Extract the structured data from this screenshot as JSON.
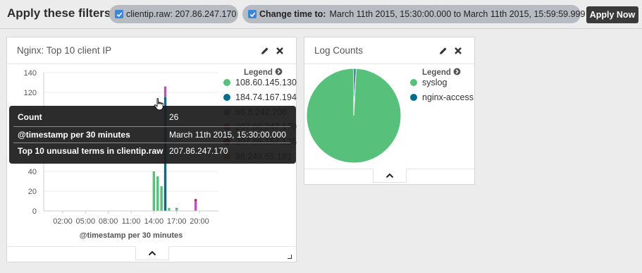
{
  "filters": {
    "title": "Apply these filters?",
    "pill1": {
      "text": "clientip.raw: 207.86.247.170"
    },
    "pill2": {
      "bold": "Change time to:",
      "text": "March 11th 2015, 15:30:00.000 to March 11th 2015, 15:59:59.999"
    },
    "apply_label": "Apply Now"
  },
  "nginx_panel": {
    "title": "Nginx: Top 10 client IP",
    "legend_title": "Legend",
    "legend": [
      {
        "label": "108.60.145.130",
        "color": "#57c17b"
      },
      {
        "label": "184.74.167.194",
        "color": "#006e8a"
      },
      {
        "label": "66.8.242.206",
        "color": "#6f87d8"
      },
      {
        "label": "207.86.247.170",
        "color": "#bc52bc"
      },
      {
        "label": "207.86.157.126",
        "color": "#9e3533"
      },
      {
        "label": "98.249.65.183",
        "color": "#daa05d"
      }
    ],
    "xlabel": "@timestamp per 30 minutes"
  },
  "log_panel": {
    "title": "Log Counts",
    "legend_title": "Legend",
    "legend": [
      {
        "label": "syslog",
        "color": "#57c17b"
      },
      {
        "label": "nginx-access",
        "color": "#006e8a"
      }
    ]
  },
  "tooltip": {
    "rows": [
      {
        "label": "Count",
        "value": "26"
      },
      {
        "label": "@timestamp per 30 minutes",
        "value": "March 11th 2015, 15:30:00.000"
      },
      {
        "label": "Top 10 unusual terms in clientip.raw",
        "value": "207.86.247.170"
      }
    ]
  },
  "chart_data": [
    {
      "type": "bar",
      "xlabel": "@timestamp per 30 minutes",
      "ylabel": "",
      "ylim": [
        0,
        140
      ],
      "yticks": [
        0,
        20,
        40,
        60,
        80,
        100,
        120,
        140
      ],
      "xticks": [
        "02:00",
        "05:00",
        "08:00",
        "11:00",
        "14:00",
        "17:00",
        "20:00"
      ],
      "x_domain_hours": [
        -0.5,
        22.5
      ],
      "stacked": true,
      "series": [
        {
          "name": "108.60.145.130",
          "color": "#57c17b",
          "points": [
            [
              14.0,
              40
            ],
            [
              14.5,
              35
            ],
            [
              15.0,
              25
            ],
            [
              16.0,
              3
            ],
            [
              17.0,
              2
            ]
          ]
        },
        {
          "name": "184.74.167.194",
          "color": "#006e8a",
          "points": [
            [
              15.5,
              115
            ]
          ]
        },
        {
          "name": "207.86.247.170",
          "color": "#bc52bc",
          "points": [
            [
              15.5,
              11
            ],
            [
              17.0,
              1
            ],
            [
              19.5,
              10
            ]
          ]
        },
        {
          "name": "207.86.157.126",
          "color": "#9e3533",
          "points": [
            [
              19.5,
              2
            ]
          ]
        }
      ]
    },
    {
      "type": "pie",
      "title": "Log Counts",
      "labels": [
        "syslog",
        "nginx-access"
      ],
      "values": [
        99.2,
        0.8
      ],
      "colors": [
        "#57c17b",
        "#006e8a"
      ]
    }
  ]
}
